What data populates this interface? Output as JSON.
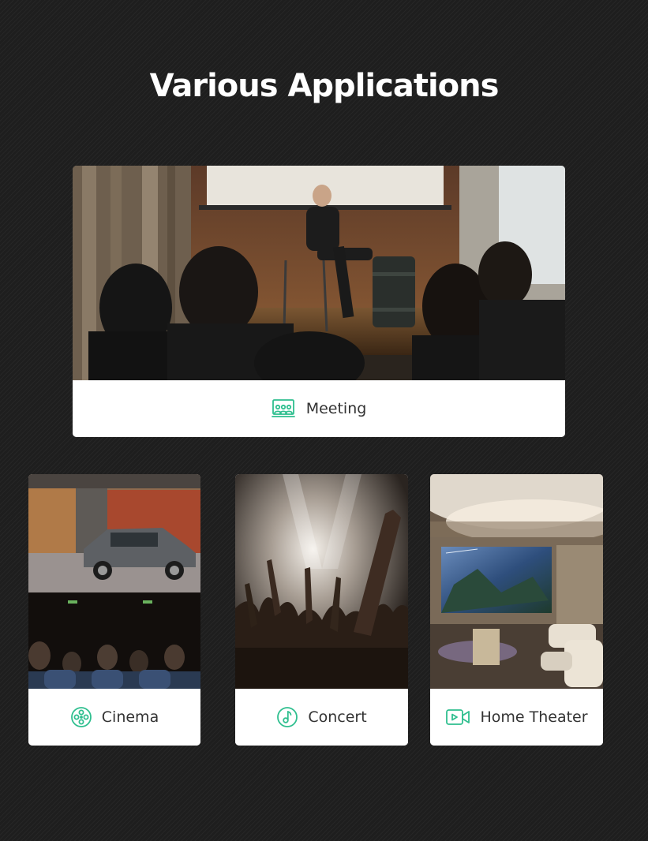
{
  "page": {
    "title": "Various Applications"
  },
  "applications": [
    {
      "label": "Meeting",
      "icon": "meeting-icon"
    },
    {
      "label": "Cinema",
      "icon": "film-reel-icon"
    },
    {
      "label": "Concert",
      "icon": "music-note-icon"
    },
    {
      "label": "Home Theater",
      "icon": "video-camera-icon"
    }
  ],
  "colors": {
    "background": "#1e1e1e",
    "accent": "#2fbf8f",
    "card": "#ffffff",
    "label_text": "#333333",
    "title_text": "#ffffff"
  }
}
